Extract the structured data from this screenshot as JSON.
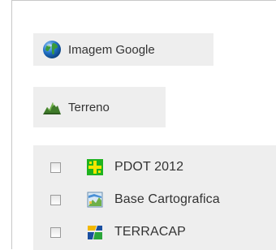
{
  "base_layers": [
    {
      "label": "Imagem Google",
      "icon": "globe-icon"
    },
    {
      "label": "Terreno",
      "icon": "terrain-icon"
    }
  ],
  "overlay_layers": [
    {
      "label": "PDOT 2012",
      "icon": "pdot-map-icon",
      "checked": false
    },
    {
      "label": "Base Cartografica",
      "icon": "cartographic-base-icon",
      "checked": false
    },
    {
      "label": "TERRACAP",
      "icon": "terracap-logo-icon",
      "checked": false
    }
  ],
  "colors": {
    "button_bg": "#eeeeee",
    "text": "#333333",
    "panel_border": "#c8c8c8"
  }
}
